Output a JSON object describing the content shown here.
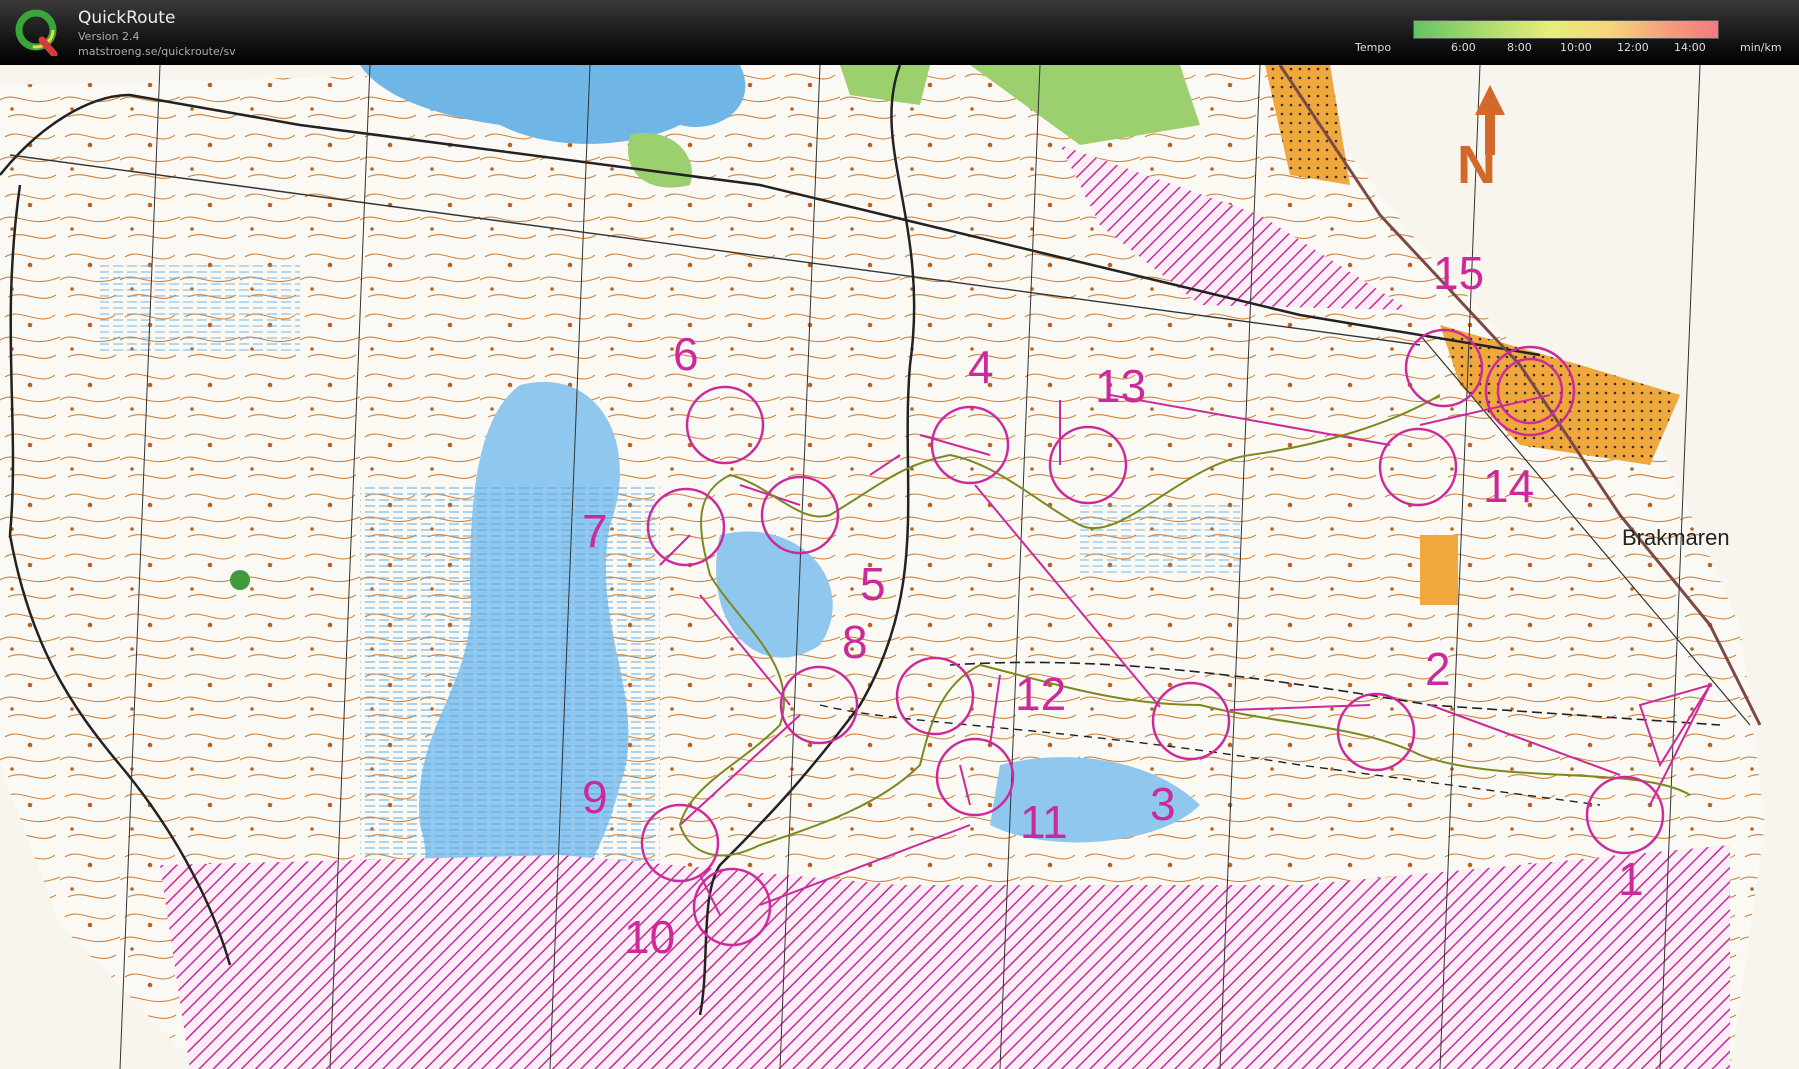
{
  "app": {
    "name": "QuickRoute",
    "version": "Version 2.4",
    "url": "matstroeng.se/quickroute/sv"
  },
  "legend": {
    "label": "Tempo",
    "ticks": [
      "6:00",
      "8:00",
      "10:00",
      "12:00",
      "14:00"
    ],
    "unit": "min/km"
  },
  "map": {
    "place_name": "Brakmaren",
    "controls": [
      {
        "number": "1"
      },
      {
        "number": "2"
      },
      {
        "number": "3"
      },
      {
        "number": "4"
      },
      {
        "number": "5"
      },
      {
        "number": "6"
      },
      {
        "number": "7"
      },
      {
        "number": "8"
      },
      {
        "number": "9"
      },
      {
        "number": "10"
      },
      {
        "number": "11"
      },
      {
        "number": "12"
      },
      {
        "number": "13"
      },
      {
        "number": "14"
      },
      {
        "number": "15"
      }
    ],
    "colors": {
      "course": "#cc2a9a",
      "contour": "#c8741e",
      "water": "#6fb6e6",
      "open": "#f3a94a",
      "green": "#9ccf6e",
      "paper": "#fbf9f3",
      "route": "#7a8a20"
    }
  }
}
